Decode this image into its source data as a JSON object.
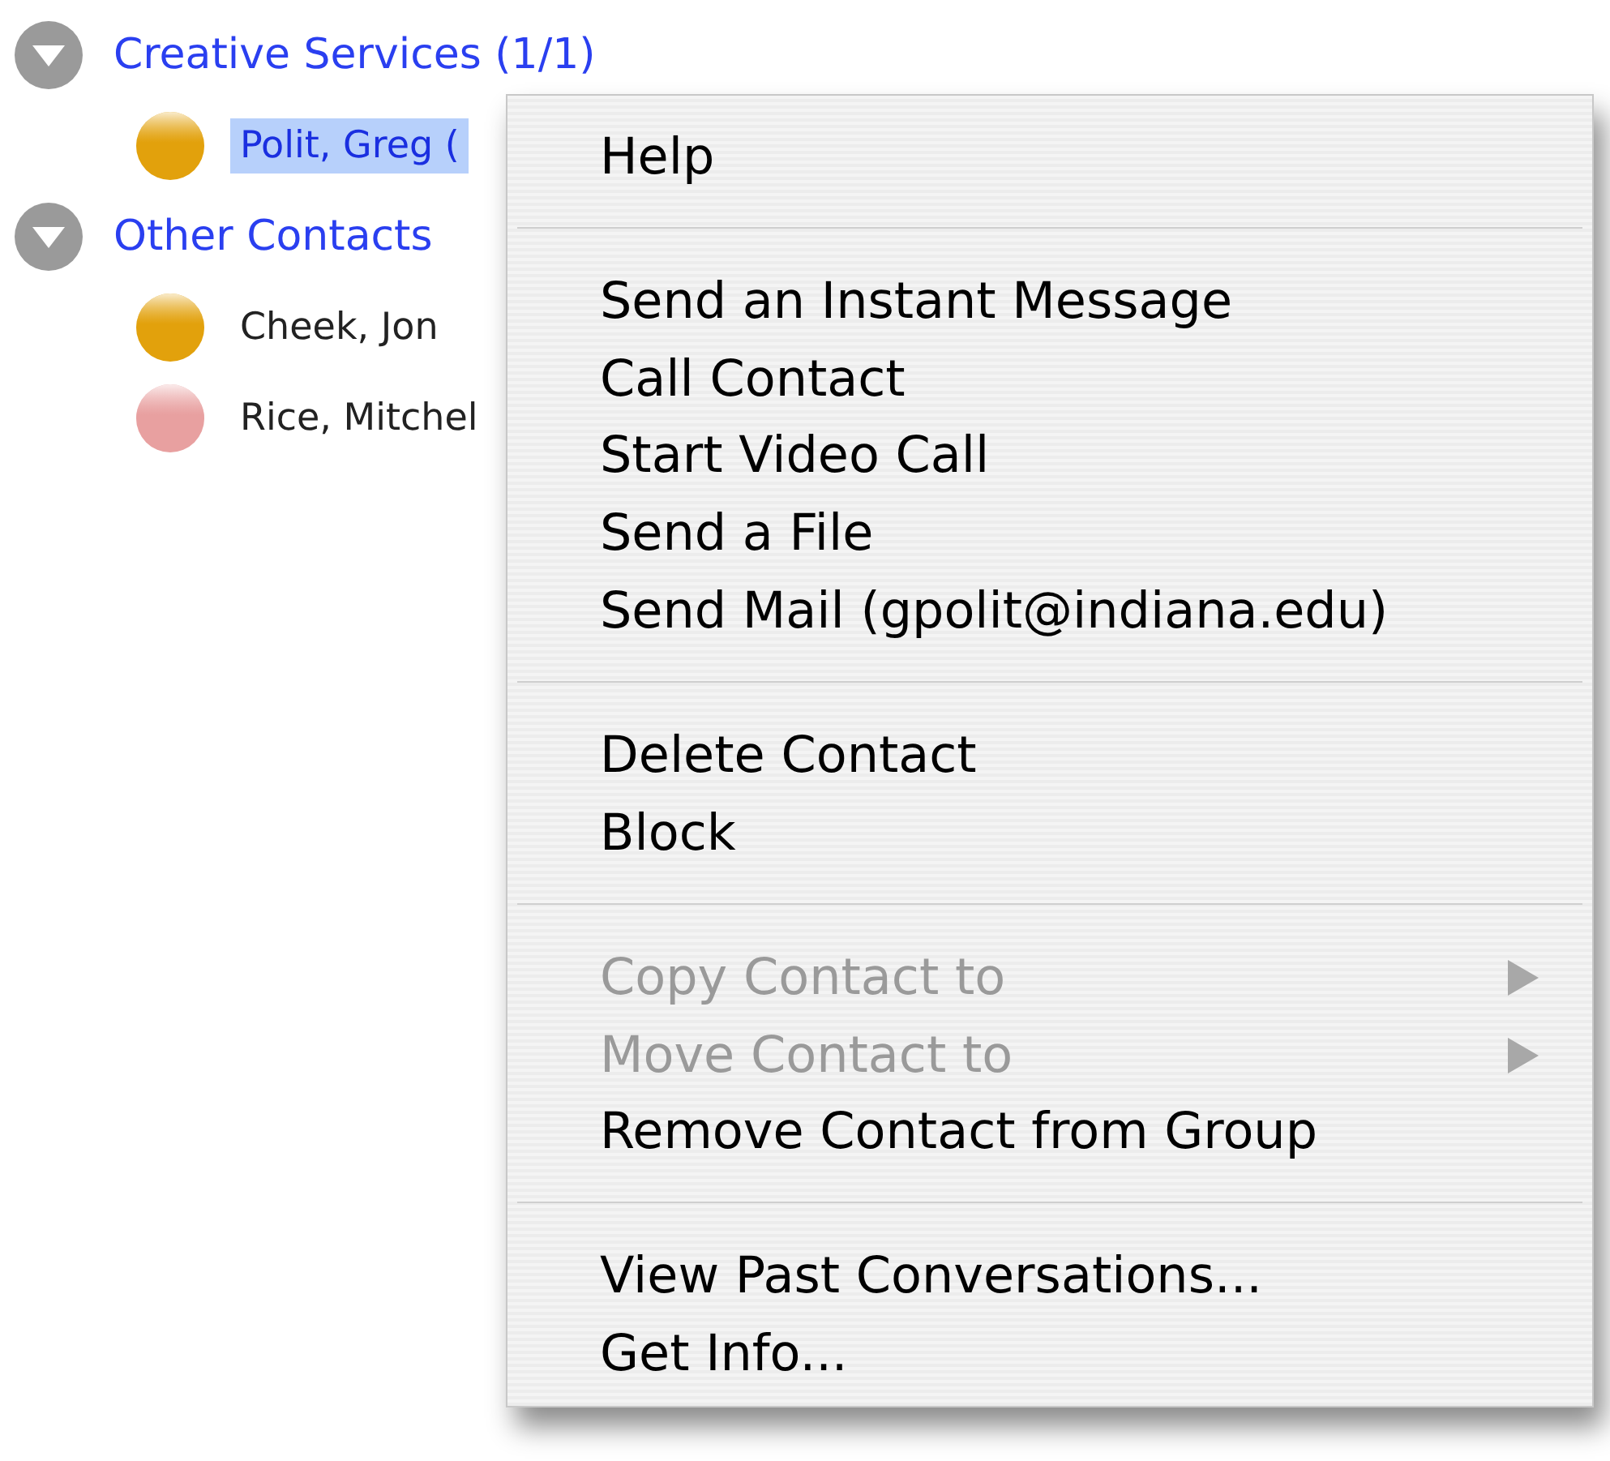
{
  "groups": [
    {
      "label": "Creative Services (1/1)",
      "expanded": true,
      "contacts": [
        {
          "name": "Polit, Greg (",
          "selected": true,
          "color": "#e2a10c"
        }
      ]
    },
    {
      "label": "Other Contacts",
      "expanded": true,
      "contacts": [
        {
          "name": "Cheek, Jon",
          "selected": false,
          "color": "#e2a10c"
        },
        {
          "name": "Rice, Mitchel",
          "selected": false,
          "color": "#e8a0a0"
        }
      ]
    }
  ],
  "context_menu": {
    "sections": [
      [
        {
          "label": "Help",
          "disabled": false,
          "submenu": false
        }
      ],
      [
        {
          "label": "Send an Instant Message",
          "disabled": false,
          "submenu": false
        },
        {
          "label": "Call Contact",
          "disabled": false,
          "submenu": false
        },
        {
          "label": "Start Video Call",
          "disabled": false,
          "submenu": false
        },
        {
          "label": "Send a File",
          "disabled": false,
          "submenu": false
        },
        {
          "label": "Send Mail (gpolit@indiana.edu)",
          "disabled": false,
          "submenu": false
        }
      ],
      [
        {
          "label": "Delete Contact",
          "disabled": false,
          "submenu": false
        },
        {
          "label": "Block",
          "disabled": false,
          "submenu": false
        }
      ],
      [
        {
          "label": "Copy Contact to",
          "disabled": true,
          "submenu": true
        },
        {
          "label": "Move Contact to",
          "disabled": true,
          "submenu": true
        },
        {
          "label": "Remove Contact from Group",
          "disabled": false,
          "submenu": false
        }
      ],
      [
        {
          "label": "View Past Conversations...",
          "disabled": false,
          "submenu": false
        },
        {
          "label": "Get Info...",
          "disabled": false,
          "submenu": false
        }
      ]
    ]
  }
}
